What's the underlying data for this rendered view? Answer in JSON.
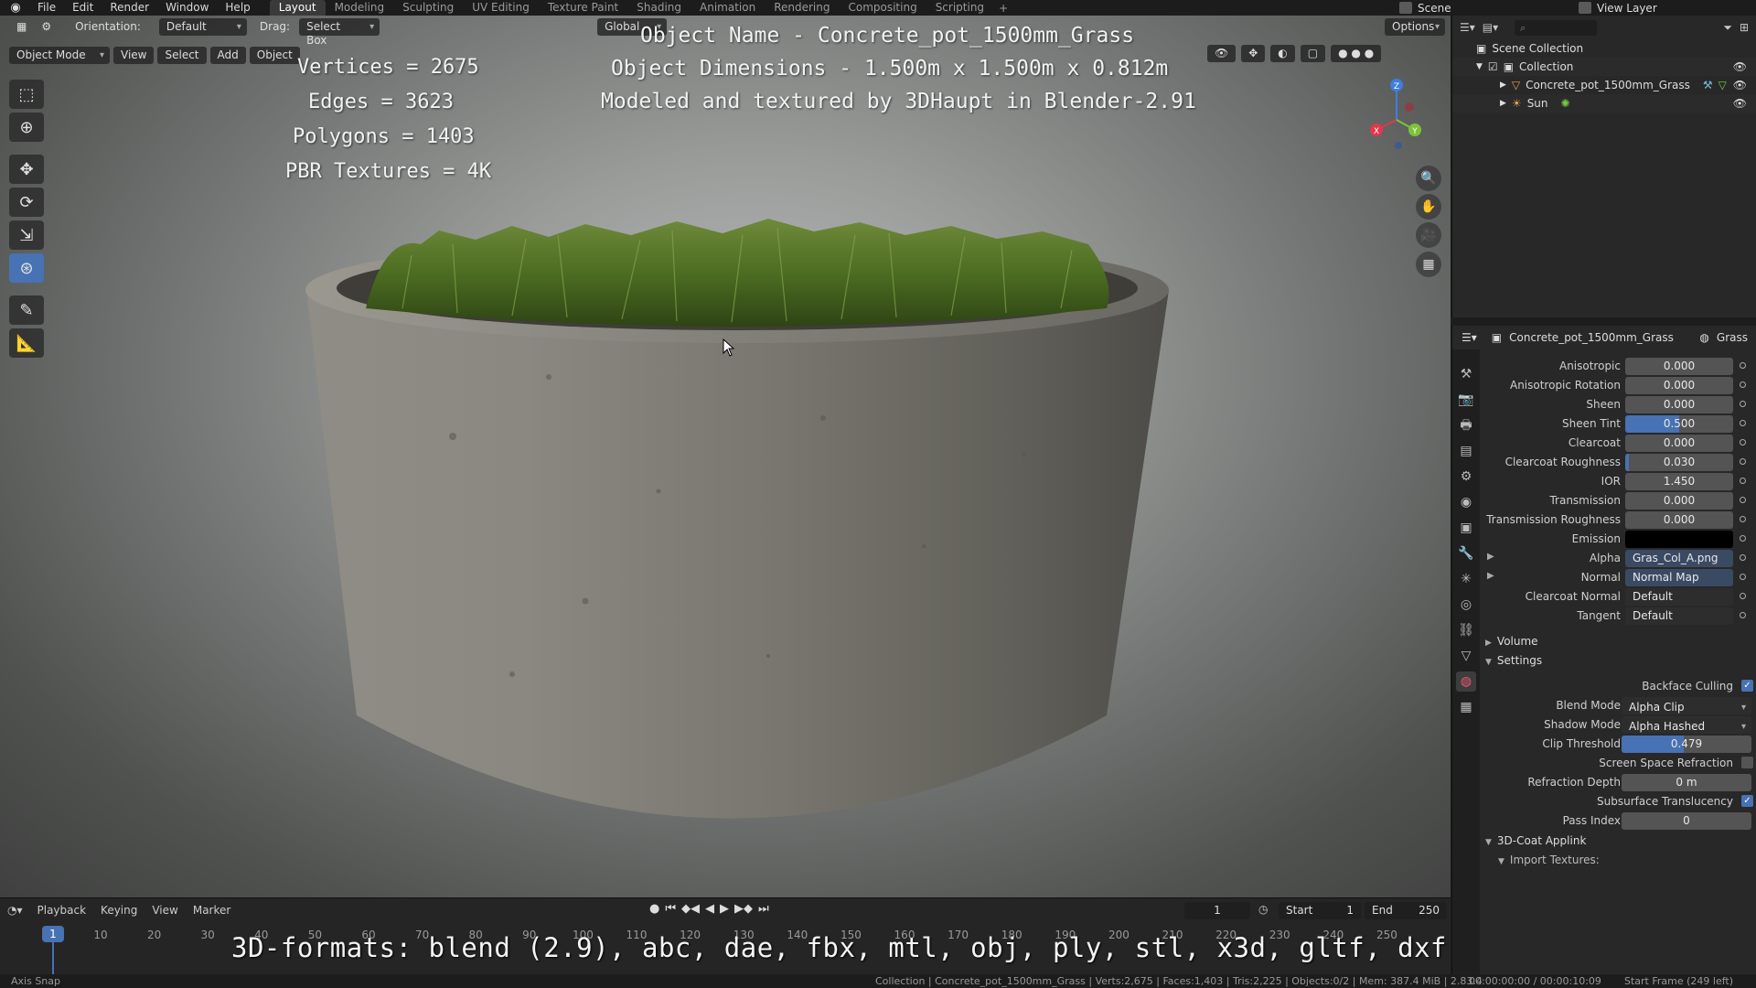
{
  "menubar": {
    "menus": [
      "File",
      "Edit",
      "Render",
      "Window",
      "Help"
    ],
    "workspaces": [
      "Layout",
      "Modeling",
      "Sculpting",
      "UV Editing",
      "Texture Paint",
      "Shading",
      "Animation",
      "Rendering",
      "Compositing",
      "Scripting"
    ],
    "active_workspace": "Layout",
    "scene": "Scene",
    "view_layer": "View Layer"
  },
  "viewport": {
    "orientation_label": "Orientation:",
    "orientation_value": "Default",
    "drag_label": "Drag:",
    "drag_value": "Select Box",
    "transform_orientation": "Global",
    "options": "Options",
    "mode": "Object Mode",
    "header_menus": [
      "View",
      "Select",
      "Add",
      "Object"
    ],
    "overlay": {
      "object_name": "Object Name - Concrete_pot_1500mm_Grass",
      "object_dimensions": "Object Dimensions -  1.500m x 1.500m x 0.812m",
      "modeled_by": "Modeled and textured by 3DHaupt in Blender-2.91",
      "vertices": "Vertices = 2675",
      "edges": "Edges = 3623",
      "polygons": "Polygons = 1403",
      "pbr_textures": "PBR Textures = 4K"
    },
    "gizmo": {
      "x": "X",
      "y": "Y",
      "z": "Z",
      "x_color": "#e0384d",
      "y_color": "#7ec23a",
      "z_color": "#3d7ee0"
    }
  },
  "timeline": {
    "menus": [
      "Playback",
      "Keying",
      "View",
      "Marker"
    ],
    "current_frame": "1",
    "start_label": "Start",
    "start_value": "1",
    "end_label": "End",
    "end_value": "250",
    "ticks": [
      "10",
      "20",
      "30",
      "40",
      "50",
      "60",
      "70",
      "80",
      "90",
      "100",
      "110",
      "120",
      "130",
      "140",
      "150",
      "160",
      "170",
      "180",
      "190",
      "200",
      "210",
      "220",
      "230",
      "240",
      "250"
    ],
    "formats_overlay": "3D-formats: blend (2.9), abc, dae, fbx, mtl, obj, ply, stl, x3d, gltf, dxf"
  },
  "statusbar": {
    "left": "Axis Snap",
    "middle": "Collection | Concrete_pot_1500mm_Grass | Verts:2,675 | Faces:1,403 | Tris:2,225 | Objects:0/2 | Mem: 387.4 MiB | 2.83.4",
    "time": "00:00:00:00 / 00:00:10:09",
    "frame_info": "Start Frame (249 left)"
  },
  "outliner": {
    "scene_collection": "Scene Collection",
    "collection": "Collection",
    "items": [
      "Concrete_pot_1500mm_Grass",
      "Sun"
    ]
  },
  "properties": {
    "object": "Concrete_pot_1500mm_Grass",
    "material": "Grass",
    "rows": [
      {
        "label": "Anisotropic",
        "value": "0.000"
      },
      {
        "label": "Anisotropic Rotation",
        "value": "0.000"
      },
      {
        "label": "Sheen",
        "value": "0.000"
      },
      {
        "label": "Sheen Tint",
        "value": "0.500",
        "fill": 0.5
      },
      {
        "label": "Clearcoat",
        "value": "0.000"
      },
      {
        "label": "Clearcoat Roughness",
        "value": "0.030",
        "fill": 0.03
      },
      {
        "label": "IOR",
        "value": "1.450"
      },
      {
        "label": "Transmission",
        "value": "0.000"
      },
      {
        "label": "Transmission Roughness",
        "value": "0.000"
      },
      {
        "label": "Emission",
        "value": ""
      },
      {
        "label": "Alpha",
        "value": "Gras_Col_A.png"
      },
      {
        "label": "Normal",
        "value": "Normal Map"
      },
      {
        "label": "Clearcoat Normal",
        "value": "Default"
      },
      {
        "label": "Tangent",
        "value": "Default"
      }
    ],
    "volume_section": "Volume",
    "settings_section": "Settings",
    "backface_culling": "Backface Culling",
    "blend_mode_label": "Blend Mode",
    "blend_mode_value": "Alpha Clip",
    "shadow_mode_label": "Shadow Mode",
    "shadow_mode_value": "Alpha Hashed",
    "clip_threshold_label": "Clip Threshold",
    "clip_threshold_value": "0.479",
    "clip_threshold_fill": 0.479,
    "ssr_label": "Screen Space Refraction",
    "refraction_depth_label": "Refraction Depth",
    "refraction_depth_value": "0 m",
    "subsurface_label": "Subsurface Translucency",
    "pass_index_label": "Pass Index",
    "pass_index_value": "0",
    "coat_section": "3D-Coat Applink",
    "import_textures": "Import Textures:"
  }
}
